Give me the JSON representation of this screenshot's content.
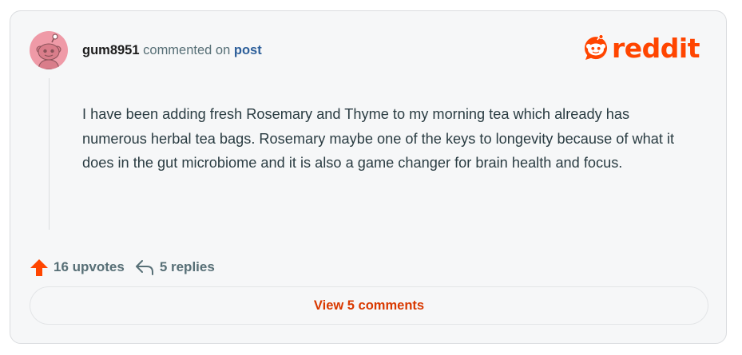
{
  "comment": {
    "username": "gum8951",
    "action_text": "commented on",
    "post_link": "post",
    "body": "I have been adding fresh Rosemary and Thyme to my morning tea which already has numerous herbal tea bags. Rosemary maybe one of the keys to longevity because of what it does in the gut microbiome and it is also a game changer for brain health and focus."
  },
  "branding": {
    "logo_text": "reddit",
    "brand_color": "#ff4500"
  },
  "avatar": {
    "background": "#ef9aa7",
    "icon": "snoo-avatar-icon"
  },
  "actions": {
    "upvotes_label": "16 upvotes",
    "replies_label": "5 replies",
    "upvote_icon": "upvote-arrow-icon",
    "reply_icon": "reply-arrow-icon"
  },
  "footer": {
    "view_comments_label": "View 5 comments"
  },
  "colors": {
    "card_background": "#f6f7f8",
    "link": "#2d5f9a",
    "button_text": "#d93900",
    "muted_text": "#576f76"
  }
}
